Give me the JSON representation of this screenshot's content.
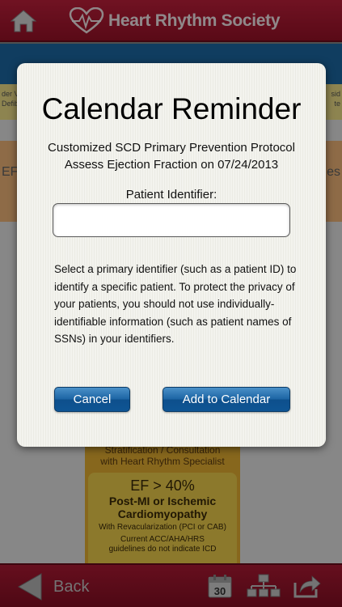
{
  "header": {
    "logo_text": "Heart Rhythm Society",
    "home_icon": "home-icon"
  },
  "background": {
    "strip_left": "der V\nDefib",
    "strip_right": "sid\nte",
    "orange_left": "EF",
    "orange_right": "es",
    "column_top": "Stratification / Consultation\nwith Heart Rhythm Specialist",
    "ef_value": "EF > 40%",
    "ef_sub": "Post-MI or Ischemic\nCardiomyopathy",
    "ef_small_1": "With Revacularization (PCI or CAB)",
    "ef_small_2": "Current ACC/AHA/HRS\nguidelines do not indicate ICD"
  },
  "dialog": {
    "title": "Calendar Reminder",
    "subtitle_1": "Customized SCD Primary Prevention Protocol",
    "subtitle_2": "Assess Ejection Fraction on 07/24/2013",
    "field_label": "Patient Identifier:",
    "field_value": "",
    "help_text": "Select a primary identifier (such as a patient ID) to identify a specific patient. To protect the privacy of your patients, you should not use individually-identifiable information (such as patient names of SSNs) in your identifiers.",
    "cancel_label": "Cancel",
    "add_label": "Add to Calendar"
  },
  "footer": {
    "back_label": "Back",
    "calendar_day": "30"
  },
  "colors": {
    "header_red": "#b01a34",
    "button_blue": "#1b64a3"
  }
}
